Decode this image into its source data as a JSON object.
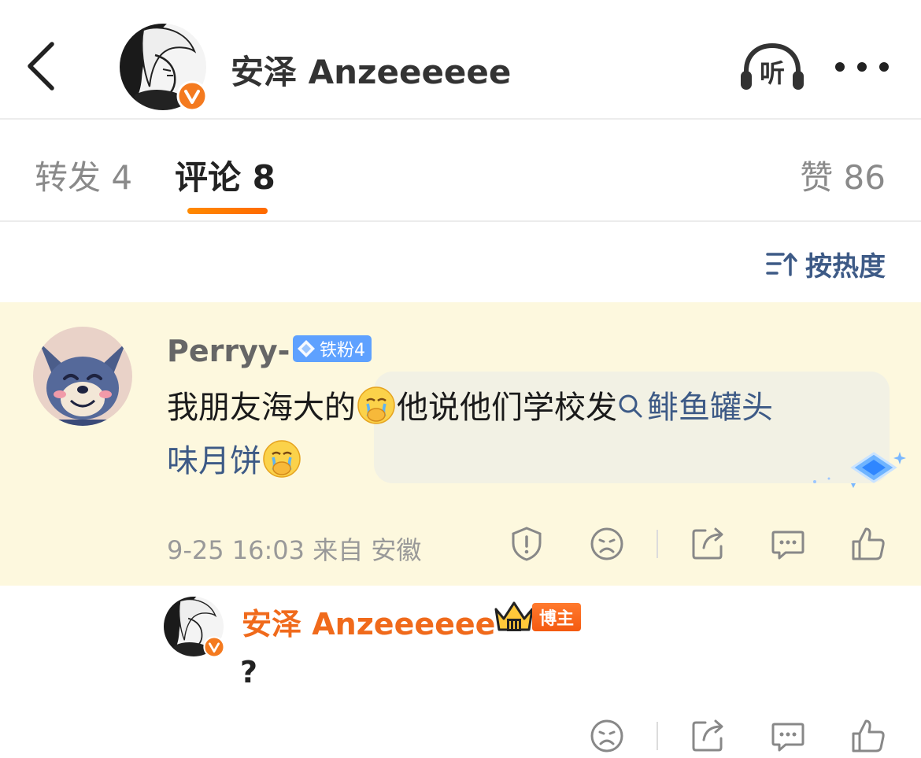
{
  "header": {
    "back_icon": "chevron-left-icon",
    "name": "安泽 Anzeeeeee",
    "listen_label": "听",
    "more_icon": "more-dots-icon"
  },
  "tabs": {
    "repost": "转发 4",
    "comments": "评论 8",
    "likes": "赞 86",
    "active": "comments"
  },
  "sort": {
    "label": "按热度",
    "icon": "sort-icon"
  },
  "comment": {
    "user": "Perryy-",
    "badge": "铁粉4",
    "text_a": "我朋友海大的",
    "text_b": "他说他们学校发",
    "topic_a": "鲱鱼罐头",
    "topic_b": "味月饼",
    "emoji": "crying-covering-mouth-emoji",
    "meta": "9-25 16:03 来自 安徽",
    "background": "#fdf8de"
  },
  "reply": {
    "user": "安泽 Anzeeeeee",
    "badge": "博主",
    "text": "?"
  },
  "colors": {
    "accent_orange": "#ff7a00",
    "link_blue": "#3d5a86",
    "fan_badge": "#5ea1ff"
  }
}
